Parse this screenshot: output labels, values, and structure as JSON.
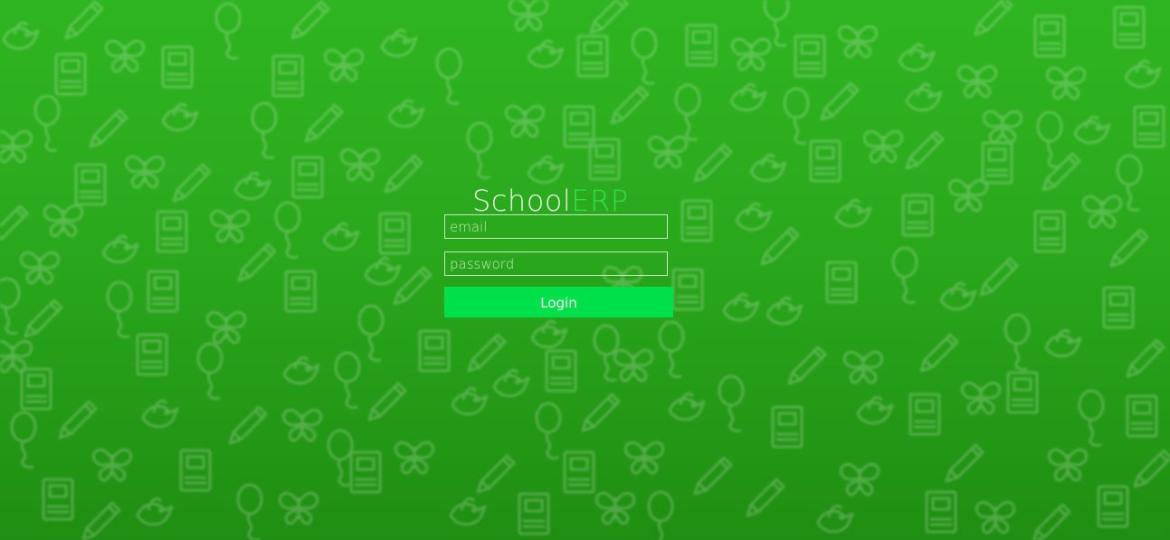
{
  "brand": {
    "part1": "School",
    "part2": "ERP"
  },
  "form": {
    "email_placeholder": "email",
    "password_placeholder": "password",
    "login_label": "Login"
  },
  "colors": {
    "background_top": "#2fb521",
    "background_bottom": "#1f8e12",
    "button": "#00e04b",
    "brand_accent": "#2ee24a"
  },
  "background_icons": [
    "pencil-icon",
    "book-icon",
    "butterfly-icon",
    "balloon-icon",
    "bird-icon"
  ]
}
